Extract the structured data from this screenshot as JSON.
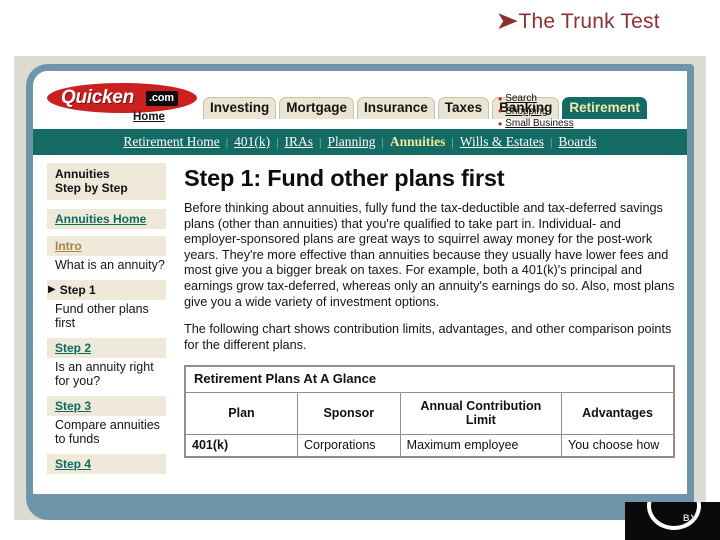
{
  "slide": {
    "bullet": "➤",
    "title": "The Trunk Test"
  },
  "colors": {
    "teal": "#136b63",
    "red": "#cc1f20",
    "steel_blue": "#6f95ab",
    "frame_beige": "#dcdcd2",
    "tab_cream": "#e9e5d2",
    "active_tab_text": "#efe8b6",
    "title_maroon": "#8a3331"
  },
  "masthead": {
    "logo_name": "Quicken",
    "logo_suffix": ".com",
    "home_label": "Home",
    "tabs": [
      {
        "label": "Investing",
        "active": false
      },
      {
        "label": "Mortgage",
        "active": false
      },
      {
        "label": "Insurance",
        "active": false
      },
      {
        "label": "Taxes",
        "active": false
      },
      {
        "label": "Banking",
        "active": false
      },
      {
        "label": "Retirement",
        "active": true
      }
    ],
    "quicklinks": [
      {
        "label": "Search"
      },
      {
        "label": "Shopping"
      },
      {
        "label": "Small Business"
      }
    ]
  },
  "subnav": {
    "separator": "|",
    "items": [
      {
        "label": "Retirement Home",
        "active": false
      },
      {
        "label": "401(k)",
        "active": false
      },
      {
        "label": "IRAs",
        "active": false
      },
      {
        "label": "Planning",
        "active": false
      },
      {
        "label": "Annuities",
        "active": true
      },
      {
        "label": "Wills & Estates",
        "active": false
      },
      {
        "label": "Boards",
        "active": false
      }
    ]
  },
  "sidebar": {
    "heading_line1": "Annuities",
    "heading_line2": "Step by Step",
    "home_link": "Annuities Home",
    "items": [
      {
        "link": "Intro",
        "desc": "What is an annuity?",
        "style": "tan",
        "current": false
      },
      {
        "link": "Step 1",
        "desc": "Fund other plans first",
        "style": "current",
        "current": true
      },
      {
        "link": "Step 2",
        "desc": "Is an annuity right for you?",
        "style": "teal",
        "current": false
      },
      {
        "link": "Step 3",
        "desc": "Compare annuities to funds",
        "style": "teal",
        "current": false
      },
      {
        "link": "Step 4",
        "desc": "",
        "style": "teal",
        "current": false
      }
    ],
    "current_marker": "▶"
  },
  "main": {
    "title": "Step 1: Fund other plans first",
    "paragraph1": "Before thinking about annuities, fully fund the tax-deductible and tax-deferred savings plans (other than annuities) that you're qualified to take part in. Individual- and employer-sponsored plans are great ways to squirrel away money for the post-work years. They're more effective than annuities because they usually have lower fees and most give you a bigger break on taxes. For example, both a 401(k)'s principal and earnings grow tax-deferred, whereas only an annuity's earnings do so. Also, most plans give you a wide variety of investment options.",
    "paragraph2": "The following chart shows contribution limits, advantages, and other comparison points for the different plans.",
    "table": {
      "caption": "Retirement Plans At A Glance",
      "columns": [
        "Plan",
        "Sponsor",
        "Annual Contribution Limit",
        "Advantages"
      ],
      "rows": [
        [
          "401(k)",
          "Corporations",
          "Maximum employee",
          "You choose how"
        ]
      ]
    }
  },
  "footer_logo": {
    "by_label": "BY"
  }
}
